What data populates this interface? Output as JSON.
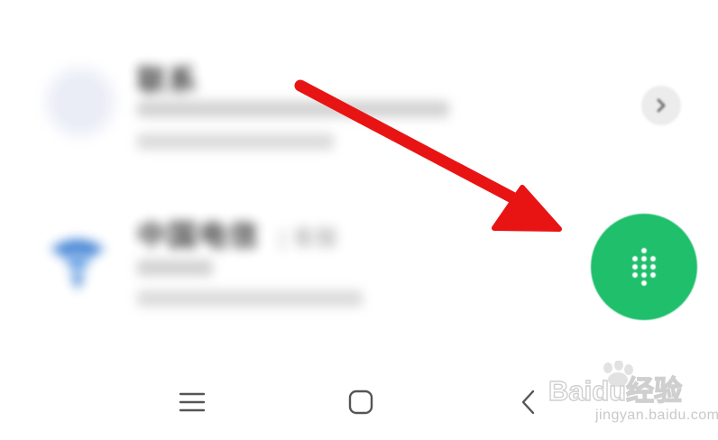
{
  "contacts": [
    {
      "title": "联系",
      "title_extra": "",
      "avatar": "person-placeholder-avatar"
    },
    {
      "title": "中国电信",
      "title_extra": "| 客服",
      "avatar": "telecom-logo"
    }
  ],
  "fab": {
    "icon": "dialpad-icon",
    "color": "#1fbf6b"
  },
  "annotation": {
    "icon": "red-arrow",
    "color": "#e81414"
  },
  "navigation": {
    "menu_icon": "menu-icon",
    "home_icon": "home-icon",
    "back_icon": "back-icon"
  },
  "watermark": {
    "brand": "Baidu经验",
    "url": "jingyan.baidu.com"
  }
}
